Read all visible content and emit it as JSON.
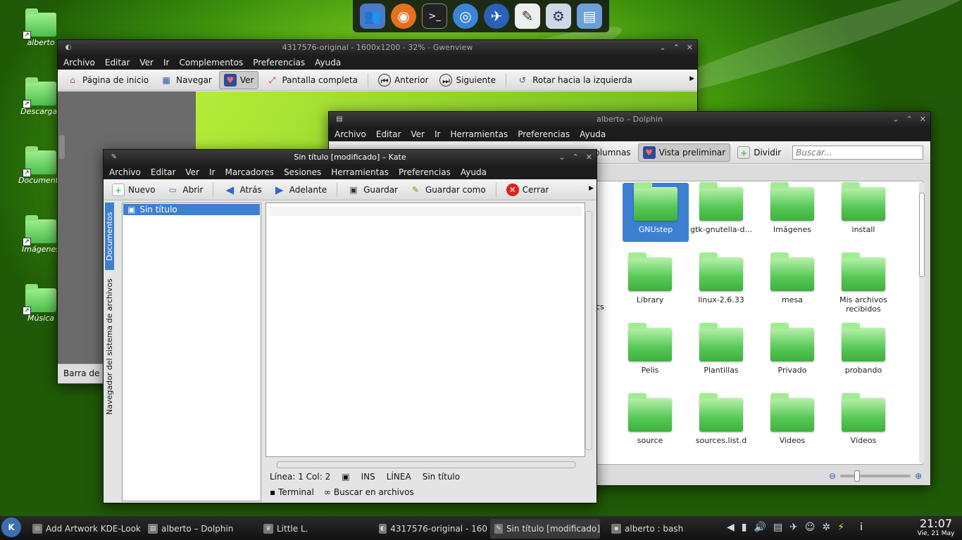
{
  "desktop": {
    "icons": [
      {
        "label": "alberto"
      },
      {
        "label": "Descargas"
      },
      {
        "label": "Documentos"
      },
      {
        "label": "Imágenes"
      },
      {
        "label": "Música"
      }
    ]
  },
  "dock": {
    "apps": [
      {
        "icon": "users-icon"
      },
      {
        "icon": "firefox-icon"
      },
      {
        "icon": "terminal-icon"
      },
      {
        "icon": "chromium-icon"
      },
      {
        "icon": "thunderbird-icon"
      },
      {
        "icon": "text-editor-icon"
      },
      {
        "icon": "settings-icon"
      },
      {
        "icon": "file-manager-icon"
      }
    ]
  },
  "gwenview": {
    "title": "4317576-original - 1600x1200 - 32% - Gwenview",
    "menu": [
      "Archivo",
      "Editar",
      "Ver",
      "Ir",
      "Complementos",
      "Preferencias",
      "Ayuda"
    ],
    "toolbar": {
      "home": "Página de inicio",
      "browse": "Navegar",
      "view": "Ver",
      "fullscreen": "Pantalla completa",
      "previous": "Anterior",
      "next": "Siguiente",
      "rotate_left": "Rotar hacia la izquierda"
    },
    "statusbar": "Barra de"
  },
  "dolphin": {
    "title": "alberto – Dolphin",
    "menu": [
      "Archivo",
      "Editar",
      "Ver",
      "Ir",
      "Herramientas",
      "Preferencias",
      "Ayuda"
    ],
    "toolbar": {
      "columns": "Columnas",
      "preview": "Vista preliminar",
      "split": "Dividir",
      "search_placeholder": "Buscar..."
    },
    "folders": [
      {
        "name": "GNUstep",
        "selected": true
      },
      {
        "name": "gtk-gnutella-d..."
      },
      {
        "name": "Imágenes"
      },
      {
        "name": "install"
      },
      {
        "name": "Library"
      },
      {
        "name": "linux-2.6.33"
      },
      {
        "name": "mesa"
      },
      {
        "name": "Mis archivos recibidos"
      },
      {
        "name": "Pelis"
      },
      {
        "name": "Plantillas"
      },
      {
        "name": "Privado"
      },
      {
        "name": "probando"
      },
      {
        "name": "source"
      },
      {
        "name": "sources.list.d"
      },
      {
        "name": "Videos"
      },
      {
        "name": "Vídeos"
      }
    ],
    "partial_label": "ics"
  },
  "kate": {
    "title": "Sin título [modificado] – Kate",
    "menu": [
      "Archivo",
      "Editar",
      "Ver",
      "Ir",
      "Marcadores",
      "Sesiones",
      "Herramientas",
      "Preferencias",
      "Ayuda"
    ],
    "toolbar": {
      "new": "Nuevo",
      "open": "Abrir",
      "back": "Atrás",
      "forward": "Adelante",
      "save": "Guardar",
      "save_as": "Guardar como",
      "close": "Cerrar"
    },
    "sidebar_tabs": {
      "documents": "Documentos",
      "filesystem": "Navegador del sistema de archivos"
    },
    "document": "Sin título",
    "status": {
      "position": "Línea: 1 Col: 2",
      "mode": "INS",
      "line_mode": "LÍNEA",
      "doc": "Sin título"
    },
    "bottom": {
      "terminal": "Terminal",
      "search": "Buscar en archivos"
    }
  },
  "taskbar": {
    "tasks": [
      "Add Artwork KDE-Look",
      "alberto – Dolphin",
      "Little L.",
      "4317576-original - 160",
      "Sin título [modificado]",
      "alberto : bash"
    ],
    "clock": {
      "time": "21:07",
      "date": "Vie, 21 May"
    }
  }
}
